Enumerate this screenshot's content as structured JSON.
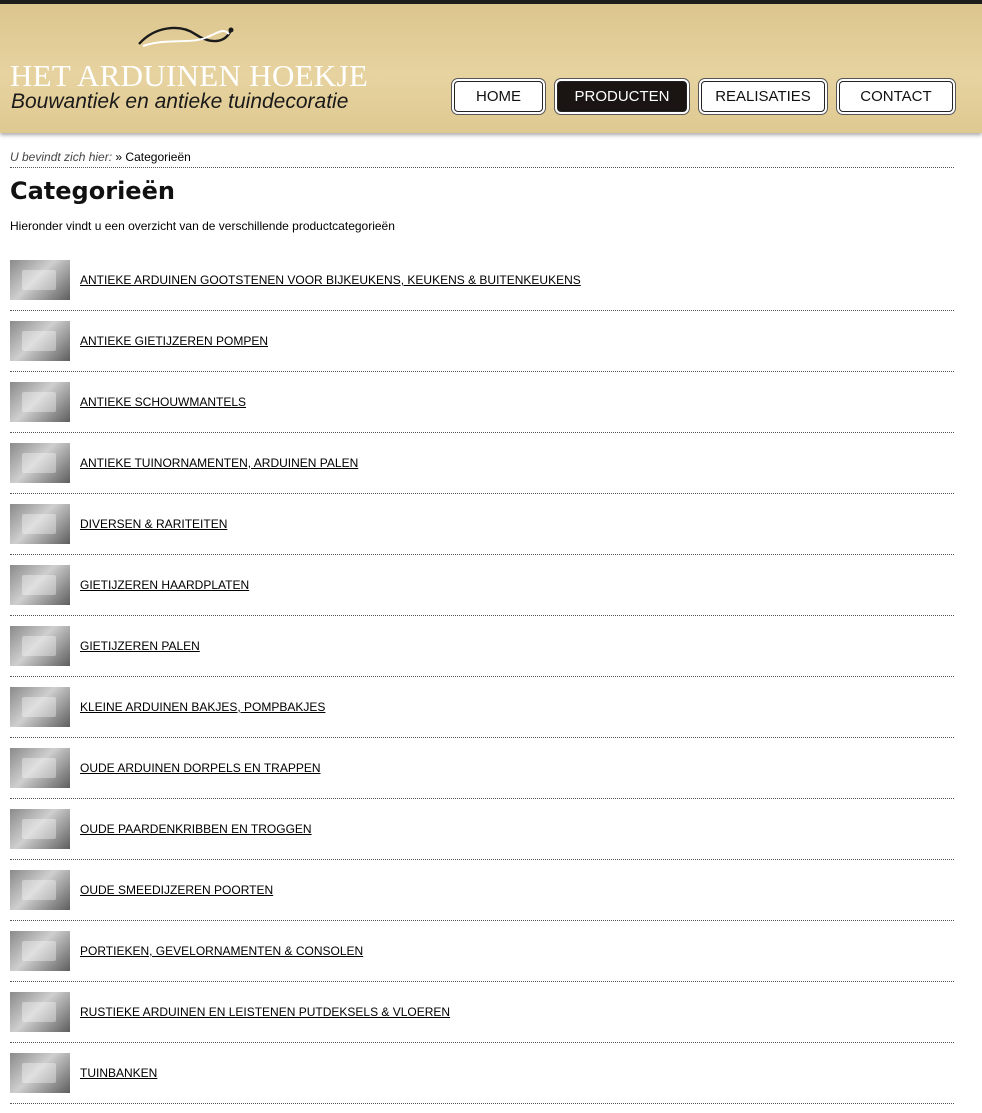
{
  "header": {
    "logo_title": "HET ARDUINEN HOEKJE",
    "logo_tagline": "Bouwantiek en antieke tuindecoratie",
    "background_color": "#e2cd98"
  },
  "nav": {
    "items": [
      {
        "label": "HOME",
        "active": false
      },
      {
        "label": "PRODUCTEN",
        "active": true
      },
      {
        "label": "REALISATIES",
        "active": false
      },
      {
        "label": "CONTACT",
        "active": false
      }
    ],
    "active_color": "#1a1513"
  },
  "breadcrumb": {
    "prefix": "U bevindt zich hier:",
    "separator": "»",
    "current": "Categorieën"
  },
  "page": {
    "title": "Categorieën",
    "intro": "Hieronder vindt u een overzicht van de verschillende productcategorieën"
  },
  "categories": [
    {
      "label": "ANTIEKE ARDUINEN GOOTSTENEN VOOR BIJKEUKENS, KEUKENS & BUITENKEUKENS"
    },
    {
      "label": "ANTIEKE GIETIJZEREN POMPEN"
    },
    {
      "label": "ANTIEKE SCHOUWMANTELS"
    },
    {
      "label": "ANTIEKE TUINORNAMENTEN, ARDUINEN PALEN"
    },
    {
      "label": "DIVERSEN & RARITEITEN"
    },
    {
      "label": "GIETIJZEREN HAARDPLATEN"
    },
    {
      "label": "GIETIJZEREN PALEN"
    },
    {
      "label": "KLEINE ARDUINEN BAKJES, POMPBAKJES"
    },
    {
      "label": "OUDE ARDUINEN DORPELS EN TRAPPEN"
    },
    {
      "label": "OUDE PAARDENKRIBBEN EN TROGGEN"
    },
    {
      "label": "OUDE SMEEDIJZEREN POORTEN"
    },
    {
      "label": "PORTIEKEN, GEVELORNAMENTEN & CONSOLEN"
    },
    {
      "label": "RUSTIEKE ARDUINEN EN LEISTENEN PUTDEKSELS & VLOEREN"
    },
    {
      "label": "TUINBANKEN"
    }
  ]
}
